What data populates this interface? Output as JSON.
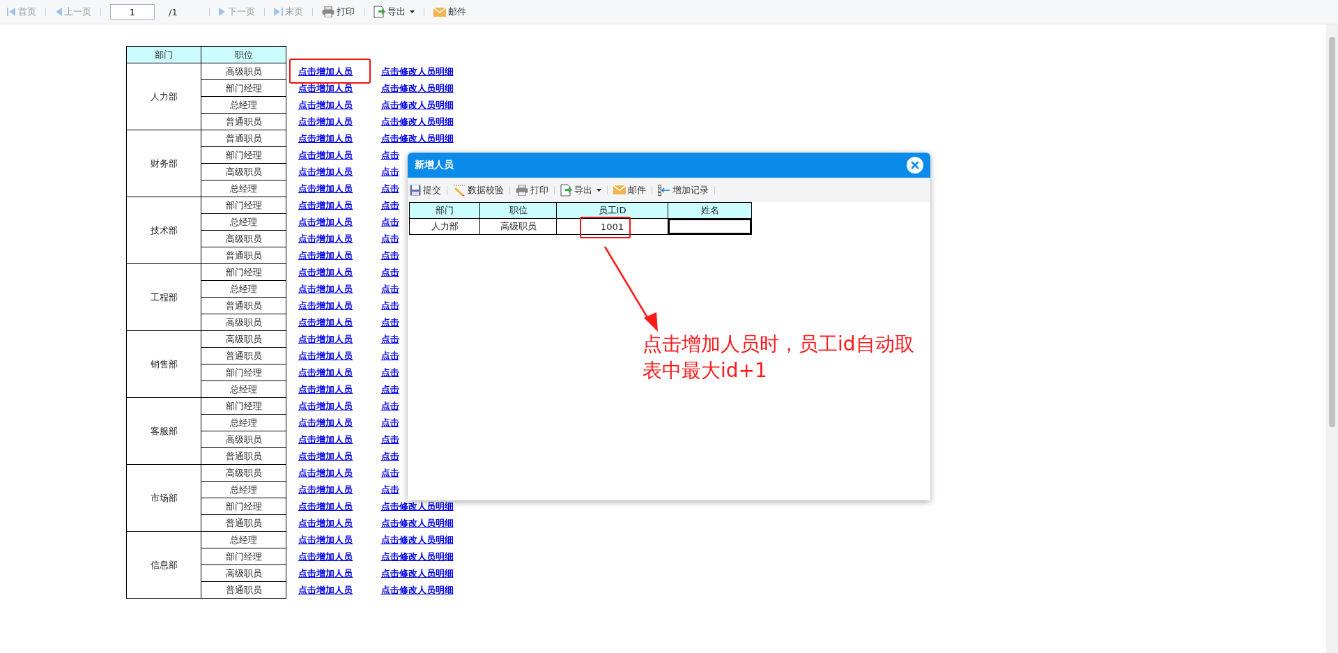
{
  "toolbar": {
    "items": [
      {
        "kind": "first",
        "label": "首页",
        "disabled": true
      },
      {
        "kind": "prev",
        "label": "上一页",
        "disabled": true
      },
      {
        "kind": "page-input",
        "label": "1"
      },
      {
        "kind": "page-total",
        "label": "/1"
      },
      {
        "kind": "next",
        "label": "下一页",
        "disabled": true
      },
      {
        "kind": "last",
        "label": "末页",
        "disabled": true
      },
      {
        "kind": "print",
        "label": "打印",
        "disabled": false
      },
      {
        "kind": "export",
        "label": "导出",
        "disabled": false
      },
      {
        "kind": "mail",
        "label": "邮件",
        "disabled": false
      }
    ]
  },
  "table": {
    "columns": [
      "部门",
      "职位"
    ],
    "departments": [
      {
        "name": "人力部",
        "positions": [
          {
            "title": "高级职员",
            "add_link": "点击增加人员",
            "edit_link": "点击修改人员明细",
            "highlighted": true
          },
          {
            "title": "部门经理",
            "add_link": "点击增加人员",
            "edit_link": "点击修改人员明细",
            "highlighted": false
          },
          {
            "title": "总经理",
            "add_link": "点击增加人员",
            "edit_link": "点击修改人员明细",
            "highlighted": false
          },
          {
            "title": "普通职员",
            "add_link": "点击增加人员",
            "edit_link": "点击修改人员明细",
            "highlighted": false
          }
        ]
      },
      {
        "name": "财务部",
        "positions": [
          {
            "title": "普通职员",
            "add_link": "点击增加人员",
            "edit_link": "点击修改人员明细",
            "highlighted": false
          },
          {
            "title": "部门经理",
            "add_link": "点击增加人员",
            "edit_link": "点击",
            "highlighted": false
          },
          {
            "title": "高级职员",
            "add_link": "点击增加人员",
            "edit_link": "点击",
            "highlighted": false
          },
          {
            "title": "总经理",
            "add_link": "点击增加人员",
            "edit_link": "点击",
            "highlighted": false
          }
        ]
      },
      {
        "name": "技术部",
        "positions": [
          {
            "title": "部门经理",
            "add_link": "点击增加人员",
            "edit_link": "点击",
            "highlighted": false
          },
          {
            "title": "总经理",
            "add_link": "点击增加人员",
            "edit_link": "点击",
            "highlighted": false
          },
          {
            "title": "高级职员",
            "add_link": "点击增加人员",
            "edit_link": "点击",
            "highlighted": false
          },
          {
            "title": "普通职员",
            "add_link": "点击增加人员",
            "edit_link": "点击",
            "highlighted": false
          }
        ]
      },
      {
        "name": "工程部",
        "positions": [
          {
            "title": "部门经理",
            "add_link": "点击增加人员",
            "edit_link": "点击",
            "highlighted": false
          },
          {
            "title": "总经理",
            "add_link": "点击增加人员",
            "edit_link": "点击",
            "highlighted": false
          },
          {
            "title": "普通职员",
            "add_link": "点击增加人员",
            "edit_link": "点击",
            "highlighted": false
          },
          {
            "title": "高级职员",
            "add_link": "点击增加人员",
            "edit_link": "点击",
            "highlighted": false
          }
        ]
      },
      {
        "name": "销售部",
        "positions": [
          {
            "title": "高级职员",
            "add_link": "点击增加人员",
            "edit_link": "点击",
            "highlighted": false
          },
          {
            "title": "普通职员",
            "add_link": "点击增加人员",
            "edit_link": "点击",
            "highlighted": false
          },
          {
            "title": "部门经理",
            "add_link": "点击增加人员",
            "edit_link": "点击",
            "highlighted": false
          },
          {
            "title": "总经理",
            "add_link": "点击增加人员",
            "edit_link": "点击",
            "highlighted": false
          }
        ]
      },
      {
        "name": "客服部",
        "positions": [
          {
            "title": "部门经理",
            "add_link": "点击增加人员",
            "edit_link": "点击",
            "highlighted": false
          },
          {
            "title": "总经理",
            "add_link": "点击增加人员",
            "edit_link": "点击",
            "highlighted": false
          },
          {
            "title": "高级职员",
            "add_link": "点击增加人员",
            "edit_link": "点击",
            "highlighted": false
          },
          {
            "title": "普通职员",
            "add_link": "点击增加人员",
            "edit_link": "点击",
            "highlighted": false
          }
        ]
      },
      {
        "name": "市场部",
        "positions": [
          {
            "title": "高级职员",
            "add_link": "点击增加人员",
            "edit_link": "点击",
            "highlighted": false
          },
          {
            "title": "总经理",
            "add_link": "点击增加人员",
            "edit_link": "点击",
            "highlighted": false
          },
          {
            "title": "部门经理",
            "add_link": "点击增加人员",
            "edit_link": "点击修改人员明细",
            "highlighted": false
          },
          {
            "title": "普通职员",
            "add_link": "点击增加人员",
            "edit_link": "点击修改人员明细",
            "highlighted": false
          }
        ]
      },
      {
        "name": "信息部",
        "positions": [
          {
            "title": "总经理",
            "add_link": "点击增加人员",
            "edit_link": "点击修改人员明细",
            "highlighted": false
          },
          {
            "title": "部门经理",
            "add_link": "点击增加人员",
            "edit_link": "点击修改人员明细",
            "highlighted": false
          },
          {
            "title": "高级职员",
            "add_link": "点击增加人员",
            "edit_link": "点击修改人员明细",
            "highlighted": false
          },
          {
            "title": "普通职员",
            "add_link": "点击增加人员",
            "edit_link": "点击修改人员明细",
            "highlighted": false
          }
        ]
      }
    ]
  },
  "dialog": {
    "title": "新增人员",
    "toolbar": [
      {
        "kind": "submit",
        "label": "提交"
      },
      {
        "kind": "validate",
        "label": "数据校验"
      },
      {
        "kind": "print",
        "label": "打印"
      },
      {
        "kind": "export",
        "label": "导出"
      },
      {
        "kind": "mail",
        "label": "邮件"
      },
      {
        "kind": "add-record",
        "label": "增加记录"
      }
    ],
    "columns": [
      "部门",
      "职位",
      "员工ID",
      "姓名"
    ],
    "row": [
      {
        "kind": "text",
        "text": "人力部",
        "highlighted": false
      },
      {
        "kind": "text",
        "text": "高级职员",
        "highlighted": false
      },
      {
        "kind": "text",
        "text": "1001",
        "highlighted": true
      },
      {
        "kind": "input",
        "selected": true
      }
    ]
  },
  "note": {
    "lines": [
      "点击增加人员时，员工id自动取",
      "表中最大id+1"
    ]
  }
}
